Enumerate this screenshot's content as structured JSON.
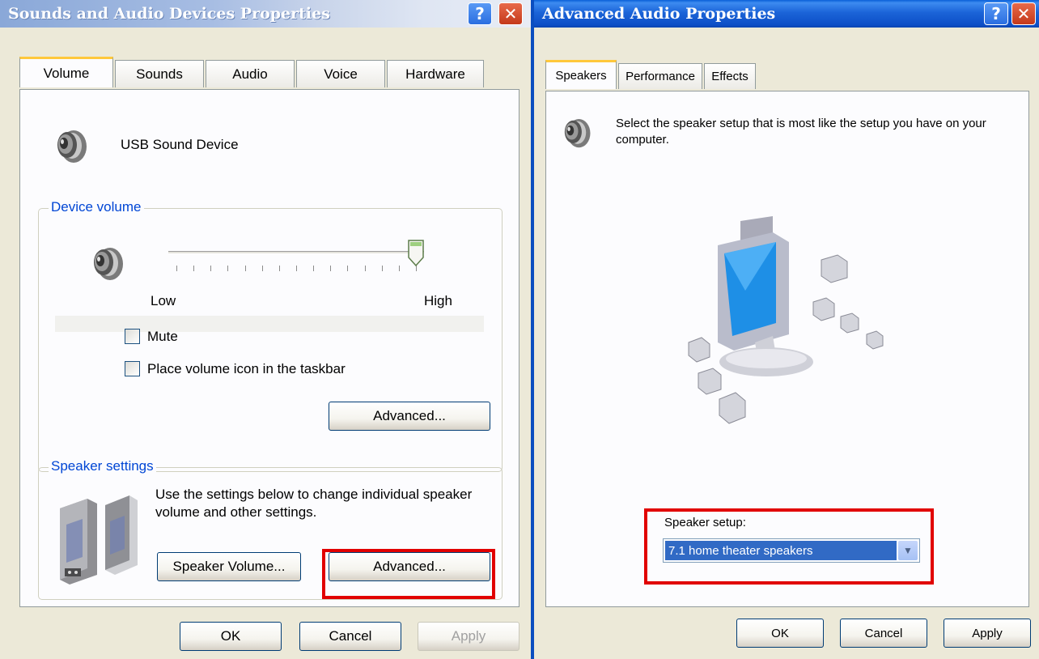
{
  "left_window": {
    "title": "Sounds and Audio Devices Properties",
    "help_label": "?",
    "close_label": "✕",
    "tabs": [
      {
        "label": "Volume"
      },
      {
        "label": "Sounds"
      },
      {
        "label": "Audio"
      },
      {
        "label": "Voice"
      },
      {
        "label": "Hardware"
      }
    ],
    "device_name": "USB Sound Device",
    "device_volume": {
      "legend": "Device volume",
      "low_label": "Low",
      "high_label": "High",
      "level": 1.0,
      "mute_label": "Mute",
      "mute_checked": false,
      "taskbar_label": "Place volume icon in the taskbar",
      "taskbar_checked": false,
      "advanced_label": "Advanced..."
    },
    "speaker_settings": {
      "legend": "Speaker settings",
      "description": "Use the settings below to change individual speaker volume and other settings.",
      "speaker_volume_label": "Speaker Volume...",
      "advanced_label": "Advanced..."
    },
    "footer": {
      "ok_label": "OK",
      "cancel_label": "Cancel",
      "apply_label": "Apply"
    }
  },
  "right_window": {
    "title": "Advanced Audio Properties",
    "help_label": "?",
    "close_label": "✕",
    "tabs": [
      {
        "label": "Speakers"
      },
      {
        "label": "Performance"
      },
      {
        "label": "Effects"
      }
    ],
    "description": "Select the speaker setup that is most like the setup you have on your computer.",
    "speaker_setup_label": "Speaker setup:",
    "speaker_setup_value": "7.1 home theater speakers",
    "footer": {
      "ok_label": "OK",
      "cancel_label": "Cancel",
      "apply_label": "Apply"
    }
  },
  "colors": {
    "highlight_red": "#e10000",
    "selection_blue": "#316ac5",
    "groupbox_legend": "#0046d5"
  }
}
